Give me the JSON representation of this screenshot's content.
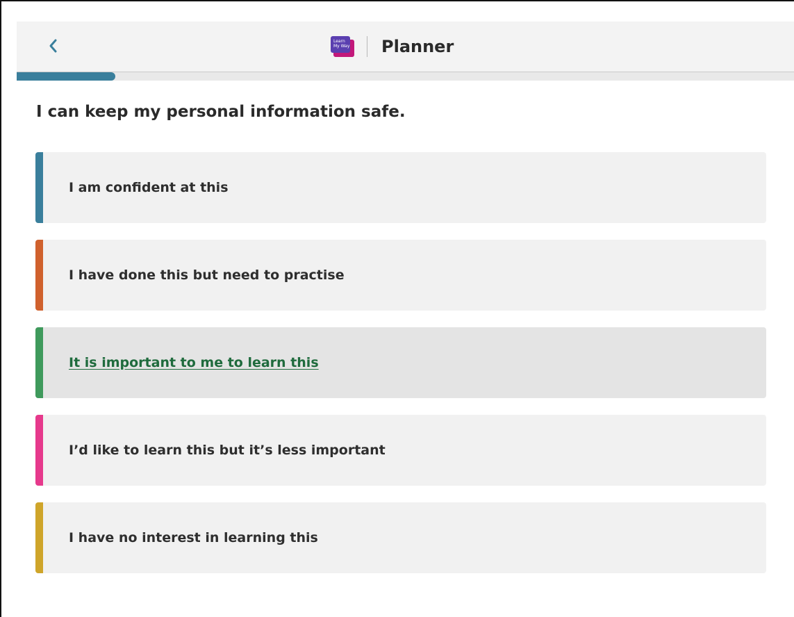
{
  "header": {
    "back_icon": "chevron-left-icon",
    "logo_text": "Learn My Way",
    "title": "Planner"
  },
  "progress": {
    "fraction": 0.127,
    "color": "#3a7f9c"
  },
  "question": "I can keep my personal information safe.",
  "options": [
    {
      "label": "I am confident at this",
      "color": "#3a7f9c",
      "active": false
    },
    {
      "label": "I have done this but need to practise",
      "color": "#d0612d",
      "active": false
    },
    {
      "label": "It is important to me to learn this",
      "color": "#3f9a5c",
      "active": true
    },
    {
      "label": "I’d like to learn this but it’s less important",
      "color": "#e6398c",
      "active": false
    },
    {
      "label": "I have no interest in learning this",
      "color": "#cfa52a",
      "active": false
    }
  ]
}
